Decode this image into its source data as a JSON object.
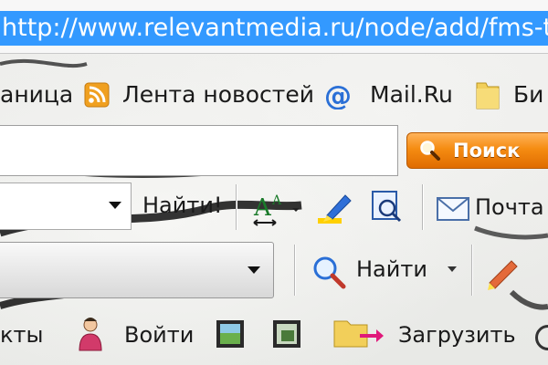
{
  "address_bar": {
    "url": "http://www.relevantmedia.ru/node/add/fms-ticket-r"
  },
  "bookmarks": {
    "items": [
      {
        "label": "аница",
        "icon": "page-icon"
      },
      {
        "label": "Лента новостей",
        "icon": "rss-feed-icon"
      },
      {
        "label": "Mail.Ru",
        "icon": "at-sign-icon"
      },
      {
        "label": "Би",
        "icon": "folder-icon"
      }
    ]
  },
  "search": {
    "query": "",
    "button_label": "Поиск"
  },
  "toolbar1": {
    "dropdown_value": "",
    "find_label": "Найти!",
    "font_size_icon": "font-size-icon",
    "highlight_icon": "highlighter-icon",
    "page_zoom_icon": "page-zoom-icon",
    "mail_label": "Почта",
    "mail_icon": "envelope-icon"
  },
  "toolbar2": {
    "dropdown_value": "",
    "find_label": "Найти",
    "search_icon": "magnifier-icon",
    "pencil_icon": "pencil-icon"
  },
  "row3": {
    "contacts_label": "кты",
    "login_label": "Войти",
    "upload_label": "Загрузить",
    "user_icon": "user-icon",
    "photo_icon": "image-icon",
    "photo_frame_icon": "image-frame-icon",
    "upload_icon": "folder-upload-icon"
  },
  "colors": {
    "url_highlight": "#3399ff",
    "search_button": "#f58c12",
    "rss": "#f0a020",
    "at_sign": "#2a6fd6",
    "folder": "#f2cf5a"
  }
}
